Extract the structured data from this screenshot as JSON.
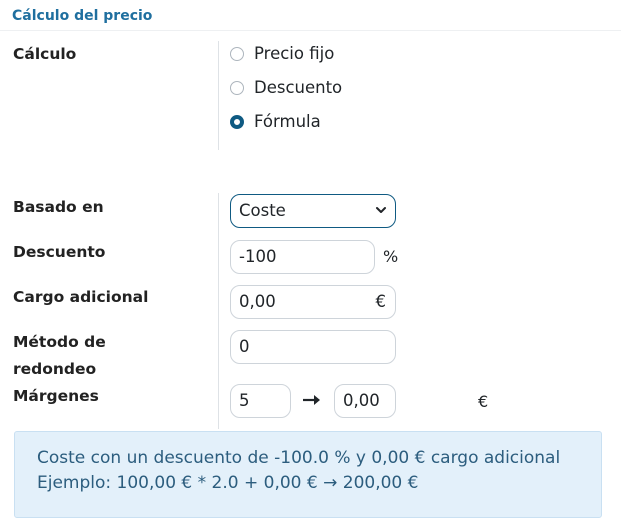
{
  "section": {
    "title": "Cálculo del precio"
  },
  "calculation": {
    "label": "Cálculo",
    "options": [
      {
        "label": "Precio fijo",
        "checked": false
      },
      {
        "label": "Descuento",
        "checked": false
      },
      {
        "label": "Fórmula",
        "checked": true
      }
    ]
  },
  "formula": {
    "based_on": {
      "label": "Basado en",
      "value": "Coste"
    },
    "discount": {
      "label": "Descuento",
      "value": "-100",
      "unit": "%"
    },
    "surcharge": {
      "label": "Cargo adicional",
      "value": "0,00",
      "unit": "€"
    },
    "rounding": {
      "label_line1": "Método de",
      "label_line2": "redondeo",
      "value": "0"
    },
    "margins": {
      "label": "Márgenes",
      "min": "5",
      "max": "0,00",
      "unit": "€"
    }
  },
  "info": {
    "line1": "Coste con un descuento de -100.0 % y 0,00 € cargo adicional",
    "line2": "Ejemplo: 100,00 € * 2.0 + 0,00 € → 200,00 €"
  },
  "colors": {
    "accent": "#0f5a82",
    "title": "#1f6f9f",
    "info_bg": "#e3f0fa",
    "info_text": "#2c5d7e"
  }
}
